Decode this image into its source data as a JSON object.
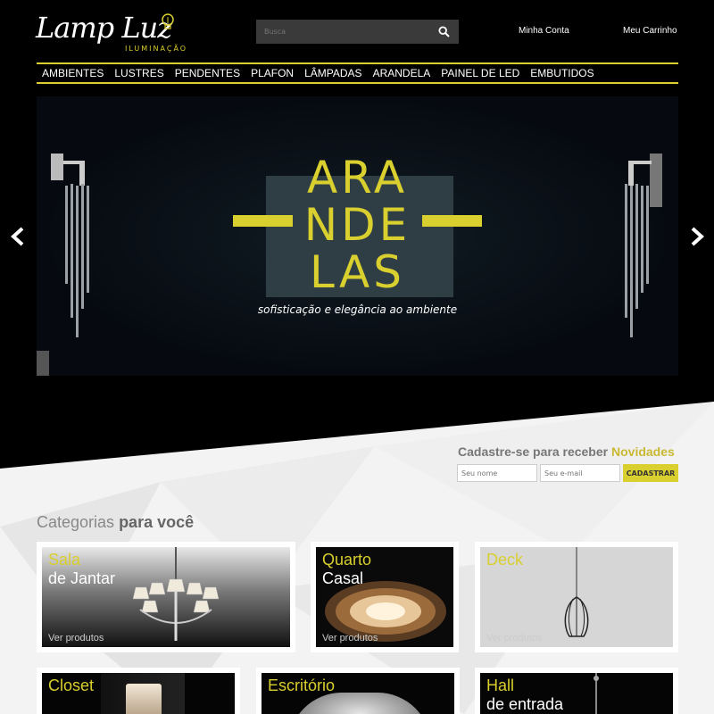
{
  "brand": {
    "name": "Lamp Luz",
    "tagline": "ILUMINAÇÃO"
  },
  "search": {
    "placeholder": "Busca"
  },
  "header": {
    "account_label": "Minha Conta",
    "cart_label": "Meu Carrinho"
  },
  "nav": {
    "items": [
      "AMBIENTES",
      "LUSTRES",
      "PENDENTES",
      "PLAFON",
      "LÂMPADAS",
      "ARANDELA",
      "PAINEL DE LED",
      "EMBUTIDOS"
    ]
  },
  "banner": {
    "line1": "ARA",
    "line2": "NDE",
    "line3": "LAS",
    "subtitle": "sofisticação e elegância ao ambiente"
  },
  "newsletter": {
    "title_prefix": "Cadastre-se para receber ",
    "title_highlight": "Novidades",
    "name_placeholder": "Seu nome",
    "email_placeholder": "Seu e-mail",
    "button": "CADASTRAR"
  },
  "categories": {
    "title_prefix": "Categorias ",
    "title_bold": "para você",
    "items": [
      {
        "line1": "Sala",
        "line2": "de Jantar",
        "link": "Ver produtos"
      },
      {
        "line1": "Quarto",
        "line2": "Casal",
        "link": "Ver produtos"
      },
      {
        "line1": "Deck",
        "line2": "",
        "link": "Ver produtos"
      },
      {
        "line1": "Closet",
        "line2": "",
        "link": ""
      },
      {
        "line1": "Escritório",
        "line2": "",
        "link": ""
      },
      {
        "line1": "Hall",
        "line2": "de entrada",
        "link": ""
      }
    ]
  },
  "colors": {
    "accent": "#d9cf2e",
    "background": "#000000",
    "panel": "#f3f3f3"
  }
}
